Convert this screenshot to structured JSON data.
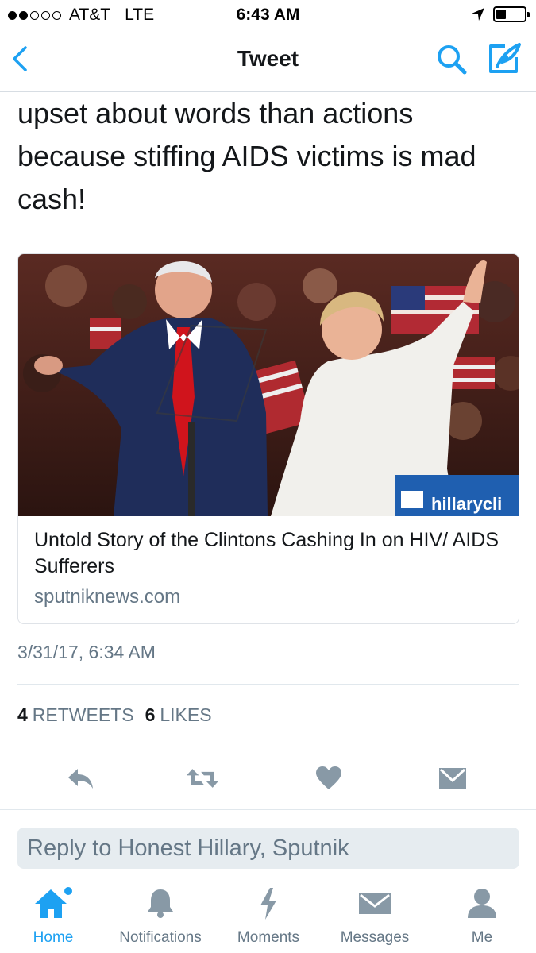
{
  "status_bar": {
    "carrier": "AT&T",
    "network": "LTE",
    "time": "6:43 AM"
  },
  "nav": {
    "title": "Tweet",
    "icons": [
      "back-chevron-icon",
      "search-icon",
      "compose-icon"
    ]
  },
  "tweet": {
    "text_lines": [
      "upset about words than actions",
      "because stiffing AIDS victims is mad",
      "cash!"
    ],
    "card": {
      "image_banner": "hillarycli",
      "title": "Untold Story of the Clintons Cashing In on HIV/ AIDS Sufferers",
      "domain": "sputniknews.com"
    },
    "timestamp": "3/31/17, 6:34 AM",
    "stats": {
      "retweets_count": "4",
      "retweets_label": "RETWEETS",
      "likes_count": "6",
      "likes_label": "LIKES"
    }
  },
  "actions": [
    "reply-icon",
    "retweet-icon",
    "like-icon",
    "direct-message-icon"
  ],
  "reply_box": {
    "placeholder": "Reply to Honest Hillary, Sputnik"
  },
  "tabbar": {
    "items": [
      {
        "label": "Home",
        "icon": "home-icon",
        "active": true
      },
      {
        "label": "Notifications",
        "icon": "bell-icon",
        "active": false
      },
      {
        "label": "Moments",
        "icon": "lightning-icon",
        "active": false
      },
      {
        "label": "Messages",
        "icon": "envelope-icon",
        "active": false
      },
      {
        "label": "Me",
        "icon": "person-icon",
        "active": false
      }
    ]
  },
  "colors": {
    "accent": "#1da1f2",
    "secondary_text": "#657786",
    "primary_text": "#14171a",
    "icon_gray": "#8899a6"
  }
}
